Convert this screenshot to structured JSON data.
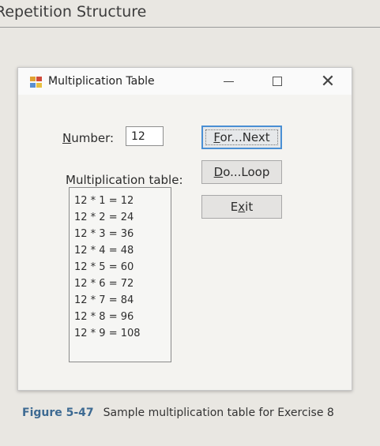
{
  "page": {
    "heading": "Repetition Structure",
    "caption_figure": "Figure 5-47",
    "caption_text": "Sample multiplication table for Exercise 8"
  },
  "window": {
    "title": "Multiplication Table",
    "controls": {
      "minimize": "minimize-icon",
      "maximize": "maximize-icon",
      "close": "close-icon"
    }
  },
  "form": {
    "number_label_u": "N",
    "number_label_rest": "umber:",
    "number_value": "12",
    "table_label": "Multiplication table:",
    "buttons": {
      "for_next_u": "F",
      "for_next_rest": "or...Next",
      "do_loop_u": "D",
      "do_loop_rest": "o...Loop",
      "exit_pre": "E",
      "exit_u": "x",
      "exit_post": "it"
    },
    "table_items": [
      "12 * 1 = 12",
      "12 * 2 = 24",
      "12 * 3 = 36",
      "12 * 4 = 48",
      "12 * 5 = 60",
      "12 * 6 = 72",
      "12 * 7 = 84",
      "12 * 8 = 96",
      "12 * 9 = 108"
    ]
  },
  "colors": {
    "focus_border": "#4a8fd4",
    "caption_figure": "#3d6a92"
  }
}
